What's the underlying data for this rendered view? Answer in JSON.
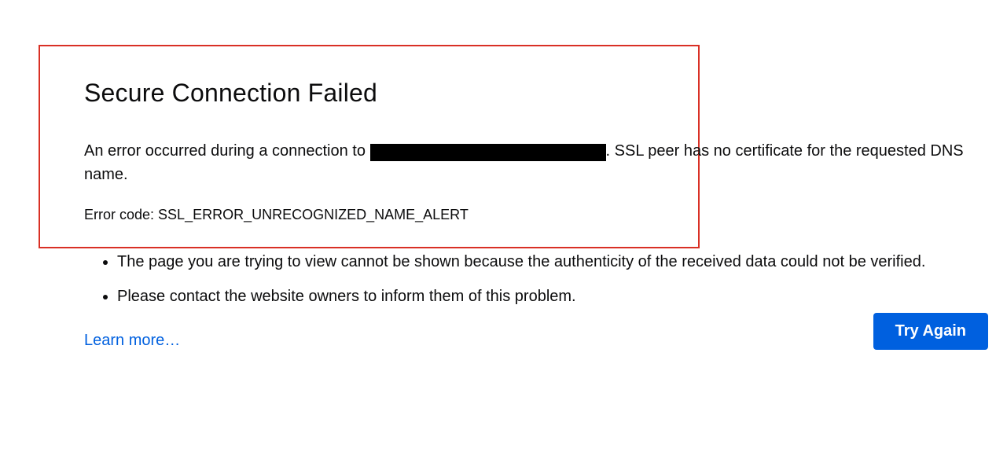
{
  "error": {
    "title": "Secure Connection Failed",
    "desc_prefix": "An error occurred during a connection to ",
    "desc_suffix": ". SSL peer has no certificate for the requested DNS name.",
    "code_label": "Error code: ",
    "code_value": "SSL_ERROR_UNRECOGNIZED_NAME_ALERT",
    "bullets": [
      "The page you are trying to view cannot be shown because the authenticity of the received data could not be verified.",
      "Please contact the website owners to inform them of this problem."
    ],
    "learn_more": "Learn more…",
    "try_again": "Try Again"
  }
}
